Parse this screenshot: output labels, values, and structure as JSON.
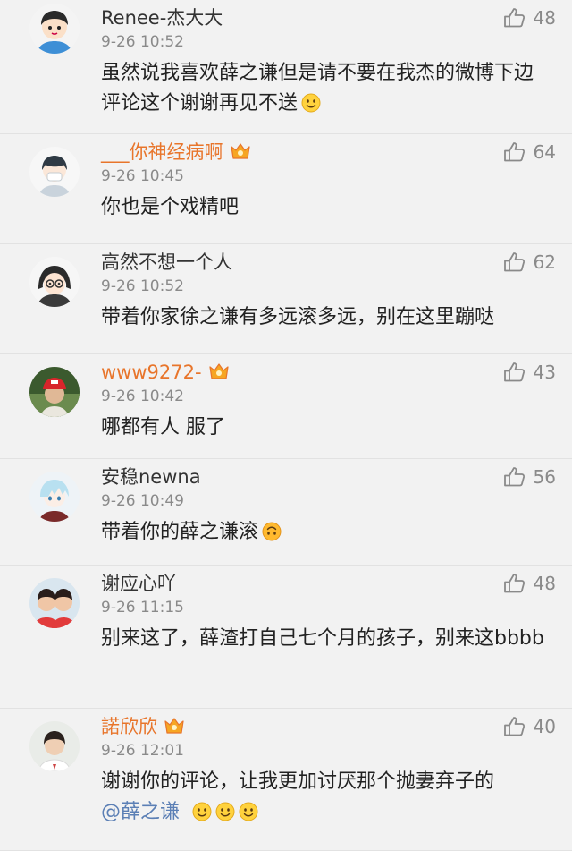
{
  "comments": [
    {
      "user": "Renee-杰大大",
      "user_color": "#333333",
      "vip": false,
      "time": "9-26 10:52",
      "text": "虽然说我喜欢薛之谦但是请不要在我杰的微博下边评论这个谢谢再见不送",
      "emojis": [
        "smile-emoji"
      ],
      "likes": "48",
      "avatar": "cartoon-boy-avatar"
    },
    {
      "user": "___你神经病啊",
      "user_color": "#e8752b",
      "vip": true,
      "time": "9-26 10:45",
      "text": "你也是个戏精吧",
      "emojis": [],
      "likes": "64",
      "avatar": "cartoon-girl-mask-avatar"
    },
    {
      "user": "高然不想一个人",
      "user_color": "#333333",
      "vip": false,
      "time": "9-26 10:52",
      "text": "带着你家徐之谦有多远滚多远，别在这里蹦哒",
      "emojis": [],
      "likes": "62",
      "avatar": "cartoon-glasses-girl-avatar"
    },
    {
      "user": "www9272-",
      "user_color": "#e8752b",
      "vip": true,
      "time": "9-26 10:42",
      "text": "哪都有人  服了",
      "emojis": [],
      "likes": "43",
      "avatar": "photo-cap-avatar"
    },
    {
      "user": "安稳newna",
      "user_color": "#333333",
      "vip": false,
      "time": "9-26 10:49",
      "text": "带着你的薛之谦滚",
      "emojis": [
        "upside-down-emoji"
      ],
      "likes": "56",
      "avatar": "anime-boy-avatar"
    },
    {
      "user": "谢应心吖",
      "user_color": "#333333",
      "vip": false,
      "time": "9-26 11:15",
      "text": "别来这了，薛渣打自己七个月的孩子，别来这bbbb",
      "emojis": [],
      "likes": "48",
      "avatar": "photo-two-people-avatar"
    },
    {
      "user": "諾欣欣",
      "user_color": "#e8752b",
      "vip": true,
      "time": "9-26 12:01",
      "text": "谢谢你的评论，让我更加讨厌那个抛妻弃子的",
      "mention": "@薛之谦",
      "emojis": [
        "smile-emoji",
        "smile-emoji",
        "smile-emoji"
      ],
      "likes": "40",
      "avatar": "photo-boy-avatar"
    }
  ]
}
